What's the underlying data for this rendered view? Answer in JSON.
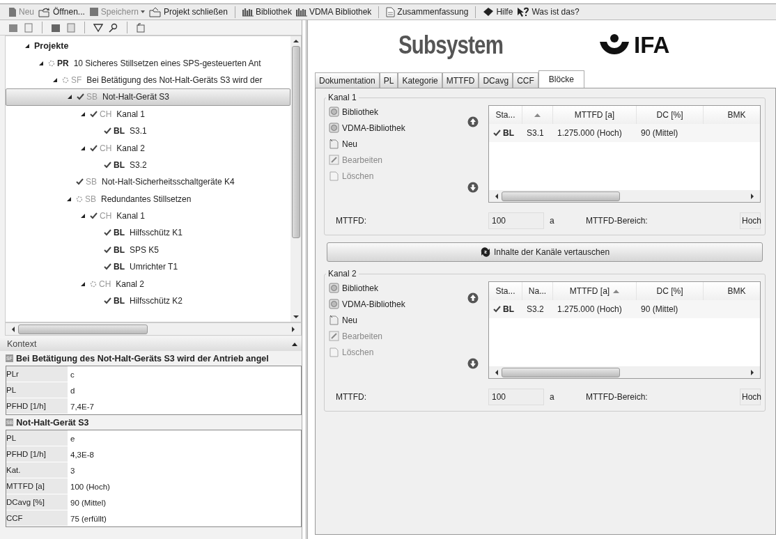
{
  "toolbar": [
    {
      "kind": "new",
      "label": "Neu",
      "disabled": true
    },
    {
      "kind": "open",
      "label": "Öffnen...",
      "disabled": false
    },
    {
      "kind": "save",
      "label": "Speichern",
      "disabled": true,
      "dropdown": true
    },
    {
      "kind": "close",
      "label": "Projekt schließen",
      "disabled": false
    },
    {
      "kind": "separator"
    },
    {
      "kind": "library",
      "label": "Bibliothek",
      "disabled": false
    },
    {
      "kind": "library",
      "label": "VDMA Bibliothek",
      "disabled": false
    },
    {
      "kind": "separator"
    },
    {
      "kind": "summary",
      "label": "Zusammenfassung",
      "disabled": false
    },
    {
      "kind": "separator"
    },
    {
      "kind": "help",
      "label": "Hilfe",
      "disabled": false
    },
    {
      "kind": "whatsthis",
      "label": "Was ist das?",
      "disabled": false
    }
  ],
  "tree": {
    "root": "Projekte",
    "expanded": true,
    "items": [
      {
        "tag": "PR",
        "checked": false,
        "label": "10 Sicheres Stillsetzen eines SPS-gesteuerten Ant",
        "expanded": true,
        "selected": false,
        "children": [
          {
            "tag": "SF",
            "checked": false,
            "label": "Bei Betätigung des Not-Halt-Geräts S3 wird der",
            "expanded": true,
            "selected": false,
            "children": [
              {
                "tag": "SB",
                "checked": true,
                "label": "Not-Halt-Gerät S3",
                "expanded": true,
                "selected": true,
                "children": [
                  {
                    "tag": "CH",
                    "checked": true,
                    "label": "Kanal 1",
                    "expanded": true,
                    "selected": false,
                    "children": [
                      {
                        "tag": "BL",
                        "checked": true,
                        "label": "S3.1",
                        "selected": false
                      }
                    ]
                  },
                  {
                    "tag": "CH",
                    "checked": true,
                    "label": "Kanal 2",
                    "expanded": true,
                    "selected": false,
                    "children": [
                      {
                        "tag": "BL",
                        "checked": true,
                        "label": "S3.2",
                        "selected": false
                      }
                    ]
                  }
                ]
              },
              {
                "tag": "SB",
                "checked": true,
                "label": "Not-Halt-Sicherheitsschaltgeräte K4",
                "selected": false
              },
              {
                "tag": "SB",
                "checked": false,
                "label": "Redundantes Stillsetzen",
                "expanded": true,
                "selected": false,
                "children": [
                  {
                    "tag": "CH",
                    "checked": true,
                    "label": "Kanal 1",
                    "expanded": true,
                    "selected": false,
                    "children": [
                      {
                        "tag": "BL",
                        "checked": true,
                        "label": "Hilfsschütz K1",
                        "selected": false
                      },
                      {
                        "tag": "BL",
                        "checked": true,
                        "label": "SPS K5",
                        "selected": false
                      },
                      {
                        "tag": "BL",
                        "checked": true,
                        "label": "Umrichter T1",
                        "selected": false
                      }
                    ]
                  },
                  {
                    "tag": "CH",
                    "checked": false,
                    "label": "Kanal 2",
                    "expanded": true,
                    "selected": false,
                    "children": [
                      {
                        "tag": "BL",
                        "checked": true,
                        "label": "Hilfsschütz K2",
                        "selected": false
                      }
                    ]
                  }
                ]
              }
            ]
          }
        ]
      }
    ]
  },
  "context": {
    "title": "Kontext",
    "sections": [
      {
        "tag": "SF",
        "title": "Bei Betätigung des Not-Halt-Geräts S3 wird der Antrieb angel",
        "rows": [
          {
            "label": "PLr",
            "value": "c"
          },
          {
            "label": "PL",
            "value": "d"
          },
          {
            "label": "PFHD [1/h]",
            "value": "7,4E-7"
          }
        ]
      },
      {
        "tag": "SB",
        "title": "Not-Halt-Gerät S3",
        "rows": [
          {
            "label": "PL",
            "value": "e"
          },
          {
            "label": "PFHD [1/h]",
            "value": "4,3E-8"
          },
          {
            "label": "Kat.",
            "value": "3"
          },
          {
            "label": "MTTFD [a]",
            "value": "100 (Hoch)"
          },
          {
            "label": "DCavg [%]",
            "value": "90 (Mittel)"
          },
          {
            "label": "CCF",
            "value": "75 (erfüllt)"
          }
        ]
      }
    ]
  },
  "header": {
    "title": "Subsystem",
    "logo": "IFA"
  },
  "tabs": [
    {
      "label": "Dokumentation",
      "selected": false
    },
    {
      "label": "PL",
      "selected": false
    },
    {
      "label": "Kategorie",
      "selected": false
    },
    {
      "label": "MTTFD",
      "selected": false
    },
    {
      "label": "DCavg",
      "selected": false
    },
    {
      "label": "CCF",
      "selected": false
    },
    {
      "label": "Blöcke",
      "selected": true
    }
  ],
  "channels": [
    {
      "title": "Kanal 1",
      "actions": [
        {
          "kind": "library",
          "label": "Bibliothek",
          "disabled": false
        },
        {
          "kind": "library",
          "label": "VDMA-Bibliothek",
          "disabled": false
        },
        {
          "kind": "new",
          "label": "Neu",
          "disabled": false
        },
        {
          "kind": "edit",
          "label": "Bearbeiten",
          "disabled": true
        },
        {
          "kind": "delete",
          "label": "Löschen",
          "disabled": true
        }
      ],
      "columns": [
        {
          "label": "Sta...",
          "sorted": false
        },
        {
          "sorted": true
        },
        {
          "label": "MTTFD [a]",
          "sorted": false
        },
        {
          "label": "DC [%]",
          "sorted": false
        },
        {
          "label": "BMK",
          "sorted": false
        }
      ],
      "rows": [
        {
          "checked": true,
          "type": "BL",
          "name": "S3.1",
          "mttfd": "1.275.000 (Hoch)",
          "dc": "90 (Mittel)"
        }
      ],
      "mttfd_label": "MTTFD:",
      "mttfd_value": "100",
      "mttfd_unit": "a",
      "range_label": "MTTFD-Bereich:",
      "range_value": "Hoch"
    },
    {
      "title": "Kanal 2",
      "actions": [
        {
          "kind": "library",
          "label": "Bibliothek",
          "disabled": false
        },
        {
          "kind": "library",
          "label": "VDMA-Bibliothek",
          "disabled": false
        },
        {
          "kind": "new",
          "label": "Neu",
          "disabled": false
        },
        {
          "kind": "edit",
          "label": "Bearbeiten",
          "disabled": true
        },
        {
          "kind": "delete",
          "label": "Löschen",
          "disabled": true
        }
      ],
      "columns": [
        {
          "label": "Sta...",
          "sorted": false
        },
        {
          "label": "Na...",
          "sorted": false
        },
        {
          "label": "MTTFD [a]",
          "sorted": true
        },
        {
          "label": "DC [%]",
          "sorted": false
        },
        {
          "label": "BMK",
          "sorted": false
        }
      ],
      "rows": [
        {
          "checked": true,
          "type": "BL",
          "name": "S3.2",
          "mttfd": "1.275.000 (Hoch)",
          "dc": "90 (Mittel)"
        }
      ],
      "mttfd_label": "MTTFD:",
      "mttfd_value": "100",
      "mttfd_unit": "a",
      "range_label": "MTTFD-Bereich:",
      "range_value": "Hoch"
    }
  ],
  "swap_button": "Inhalte der Kanäle vertauschen"
}
